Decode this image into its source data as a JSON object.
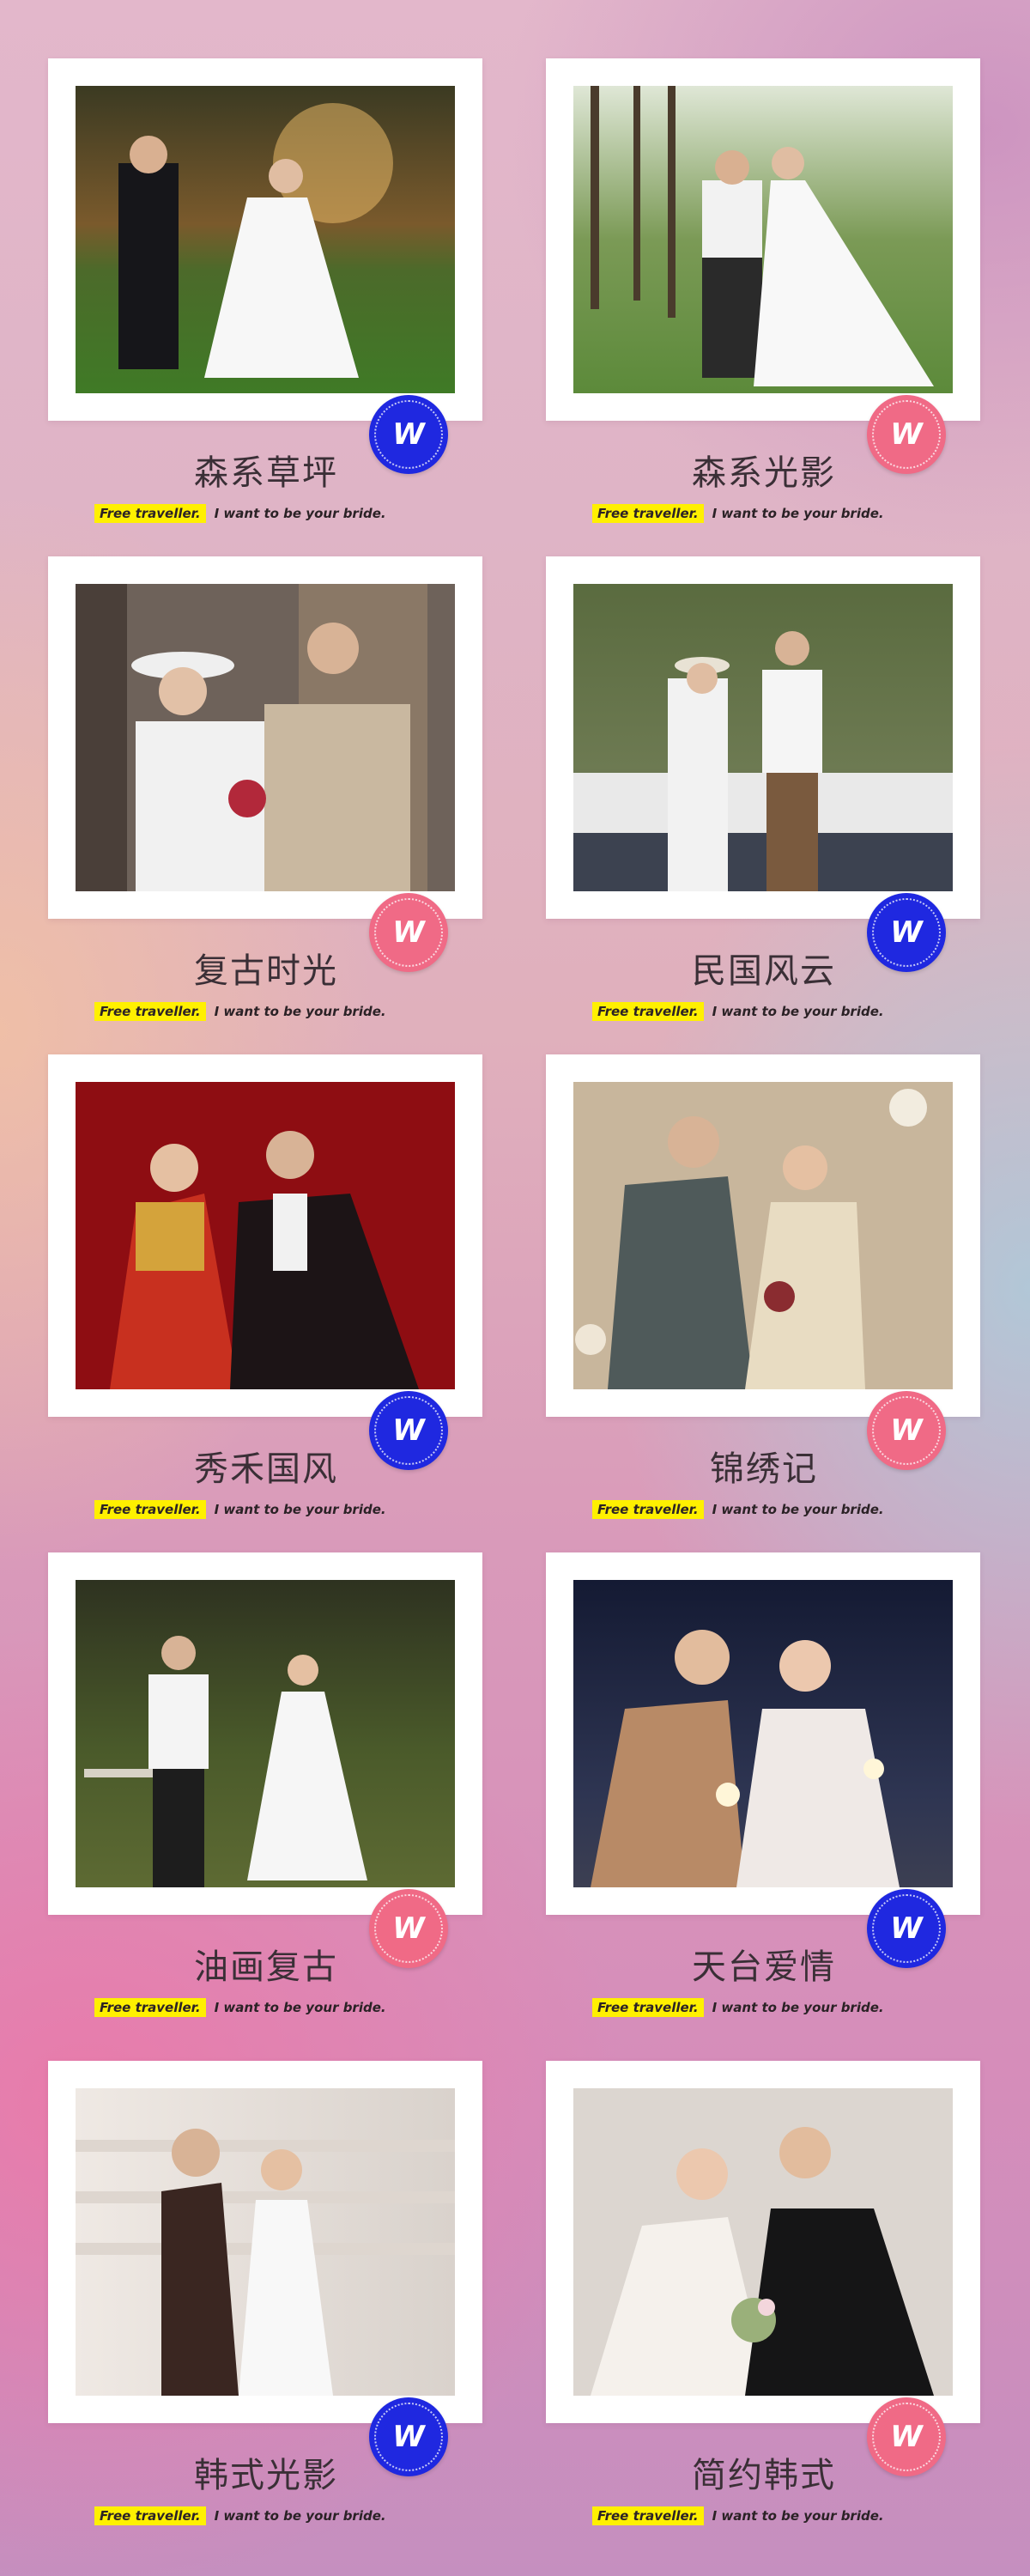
{
  "cards": [
    {
      "title": "森系草坪",
      "tag_highlight": "Free traveller.",
      "tag_text": "I want to be your bride.",
      "badge_label": "W",
      "badge_color": "#1f28e0"
    },
    {
      "title": "森系光影",
      "tag_highlight": "Free traveller.",
      "tag_text": "I want to be your bride.",
      "badge_label": "W",
      "badge_color": "#f06a86"
    },
    {
      "title": "复古时光",
      "tag_highlight": "Free traveller.",
      "tag_text": "I want to be your bride.",
      "badge_label": "W",
      "badge_color": "#f06a86"
    },
    {
      "title": "民国风云",
      "tag_highlight": "Free traveller.",
      "tag_text": "I want to be your bride.",
      "badge_label": "W",
      "badge_color": "#1f28e0"
    },
    {
      "title": "秀禾国风",
      "tag_highlight": "Free traveller.",
      "tag_text": "I want to be your bride.",
      "badge_label": "W",
      "badge_color": "#1f28e0"
    },
    {
      "title": "锦绣记",
      "tag_highlight": "Free traveller.",
      "tag_text": "I want to be your bride.",
      "badge_label": "W",
      "badge_color": "#f06a86"
    },
    {
      "title": "油画复古",
      "tag_highlight": "Free traveller.",
      "tag_text": "I want to be your bride.",
      "badge_label": "W",
      "badge_color": "#f06a86"
    },
    {
      "title": "天台爱情",
      "tag_highlight": "Free traveller.",
      "tag_text": "I want to be your bride.",
      "badge_label": "W",
      "badge_color": "#1f28e0"
    },
    {
      "title": "韩式光影",
      "tag_highlight": "Free traveller.",
      "tag_text": "I want to be your bride.",
      "badge_label": "W",
      "badge_color": "#1f28e0"
    },
    {
      "title": "简约韩式",
      "tag_highlight": "Free traveller.",
      "tag_text": "I want to be your bride.",
      "badge_label": "W",
      "badge_color": "#f06a86"
    }
  ]
}
